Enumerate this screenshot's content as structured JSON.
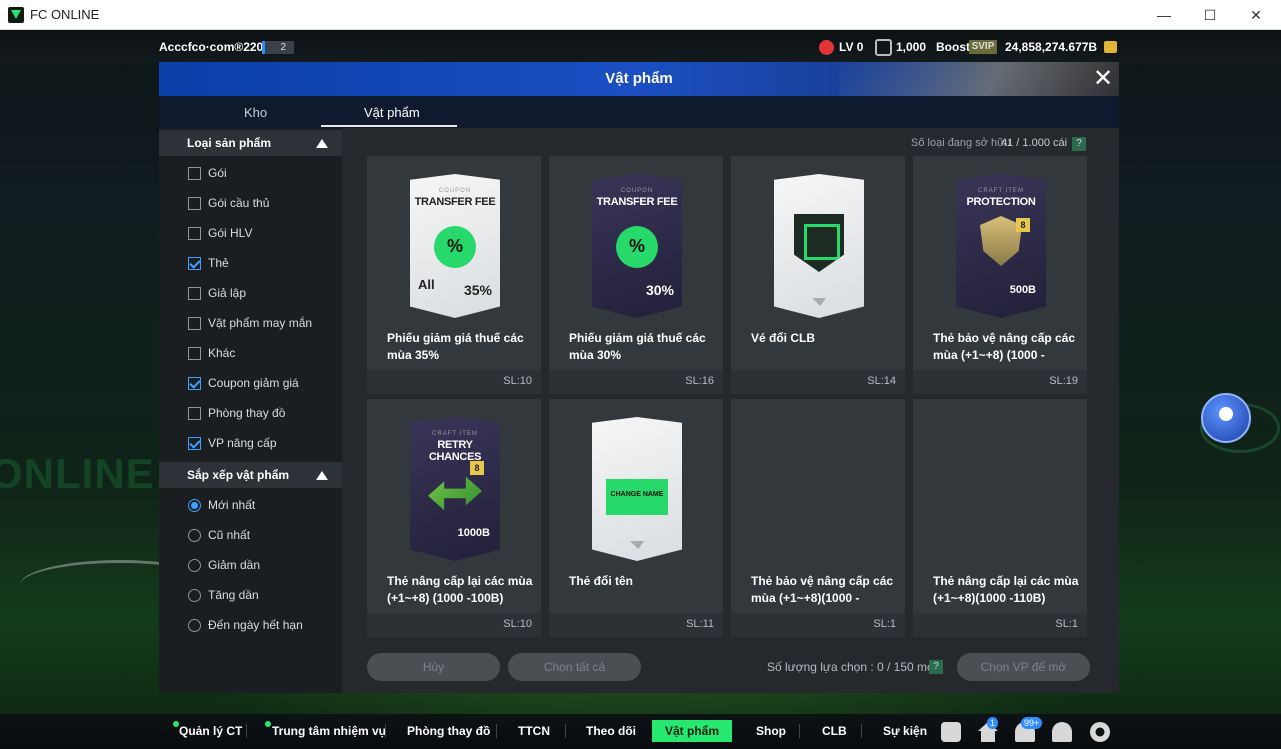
{
  "window": {
    "title": "FC ONLINE",
    "minimize": "—",
    "maximize": "☐",
    "close": "✕"
  },
  "topbar": {
    "account": "Acccfco·com®2202o",
    "account_num": "2",
    "lv": "LV 0",
    "boost_points": "1,000",
    "boost_label": "Boost",
    "svip": "SVIP",
    "coins": "24,858,274.677B"
  },
  "modal": {
    "title": "Vật phẩm",
    "close": "✕",
    "tabs": [
      {
        "label": "Kho"
      },
      {
        "label": "Vật phẩm"
      }
    ],
    "filter": {
      "product_type_header": "Loại sản phẩm",
      "product_types": [
        {
          "label": "Gói",
          "checked": false
        },
        {
          "label": "Gói cầu thủ",
          "checked": false
        },
        {
          "label": "Gói HLV",
          "checked": false
        },
        {
          "label": "Thẻ",
          "checked": true
        },
        {
          "label": "Giả lập",
          "checked": false
        },
        {
          "label": "Vật phẩm may mắn",
          "checked": false
        },
        {
          "label": "Khác",
          "checked": false
        },
        {
          "label": "Coupon giảm giá",
          "checked": true
        },
        {
          "label": "Phòng thay đồ",
          "checked": false
        },
        {
          "label": "VP nâng cấp",
          "checked": true
        }
      ],
      "sort_header": "Sắp xếp vật phẩm",
      "sort_options": [
        {
          "label": "Mới nhất",
          "selected": true
        },
        {
          "label": "Cũ nhất",
          "selected": false
        },
        {
          "label": "Giảm dần",
          "selected": false
        },
        {
          "label": "Tăng dần",
          "selected": false
        },
        {
          "label": "Đến ngày hết hạn",
          "selected": false
        }
      ]
    },
    "owned_label": "Số loại đang sở hữu",
    "owned_value": "41 / 1.000 cái",
    "help": "?",
    "items": [
      {
        "name": "Phiếu giảm giá thuế các mùa 35%",
        "qty": "SL:10",
        "card": {
          "style": "white",
          "sub": "COUPON",
          "title": "TRANSFER FEE",
          "badge": "%",
          "all": "All",
          "pct": "35%"
        }
      },
      {
        "name": "Phiếu giảm giá thuế các mùa 30%",
        "qty": "SL:16",
        "card": {
          "style": "dark",
          "sub": "COUPON",
          "title": "TRANSFER FEE",
          "badge": "%",
          "pct": "30%"
        }
      },
      {
        "name": "Vé đổi CLB",
        "qty": "SL:14",
        "card": {
          "style": "white"
        }
      },
      {
        "name": "Thẻ bảo vệ nâng cấp các mùa (+1~+8) (1000 -",
        "qty": "SL:19",
        "card": {
          "style": "dark",
          "sub": "CRAFT ITEM",
          "title": "PROTECTION",
          "level": "8",
          "amount": "500B"
        }
      },
      {
        "name": "Thẻ nâng cấp lại các mùa (+1~+8) (1000 -100B)",
        "qty": "SL:10",
        "card": {
          "style": "dark",
          "sub": "CRAFT ITEM",
          "title": "RETRY CHANCES",
          "level": "8",
          "amount": "1000B"
        }
      },
      {
        "name": "Thẻ đổi tên",
        "qty": "SL:11",
        "card": {
          "style": "white",
          "label": "CHANGE NAME"
        }
      },
      {
        "name": "Thẻ bảo vệ nâng cấp các mùa (+1~+8)(1000 -",
        "qty": "SL:1"
      },
      {
        "name": "Thẻ nâng cấp lại các mùa (+1~+8)(1000 -110B)",
        "qty": "SL:1"
      }
    ],
    "buttons": {
      "cancel": "Hủy",
      "select_all": "Chọn tất cả",
      "open": "Chọn VP để mở"
    },
    "selection_label": "Số lượng lựa chọn : 0 / 150 món"
  },
  "bottom_nav": {
    "items": [
      "Quản lý CT",
      "Trung tâm nhiệm vụ",
      "Phòng thay đồ",
      "TTCN",
      "Theo dõi",
      "Vật phẩm",
      "Shop",
      "CLB",
      "Sự kiện"
    ],
    "home_badge": "1",
    "bell_badge": "99+"
  },
  "background_text": "ONLINE",
  "colors": {
    "accent_green": "#27e86e",
    "check_blue": "#3ca0ff",
    "modal_header": "#1a4ec2"
  }
}
